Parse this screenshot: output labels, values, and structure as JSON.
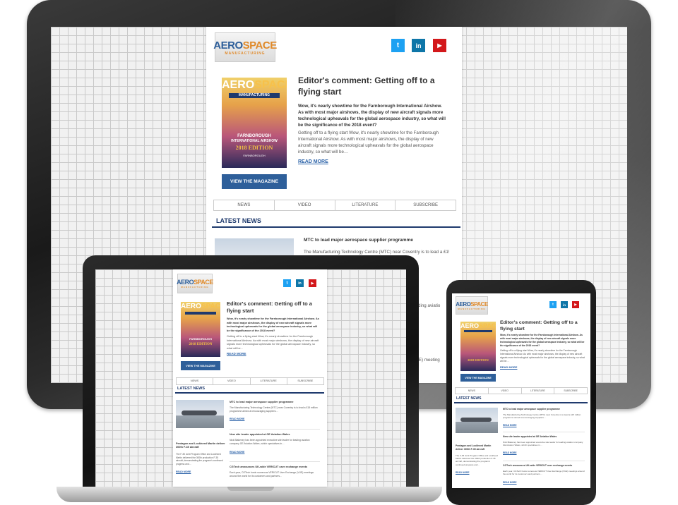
{
  "email": {
    "logo_main_a": "AERO",
    "logo_main_b": "SPACE",
    "logo_sub": "MANUFACTURING",
    "social": [
      "t",
      "in",
      "▶"
    ],
    "cover": {
      "title_a": "AERO",
      "title_b": "SPACE",
      "subtitle": "MANUFACTURING",
      "show_line1": "FARNBOROUGH",
      "show_line2": "INTERNATIONAL AIRSHOW",
      "edition": "2018 EDITION",
      "brand": "FARNBOROUGH",
      "brand_sub": "INTERNATIONAL AIRSHOW"
    },
    "headline": "Editor's comment: Getting off to a flying start",
    "intro_bold": "Wow, it's nearly showtime for the Farnborough International Airshow. As with most major airshows, the display of new aircraft signals more technological upheavals for the global aerospace industry, so what will be the significance of the 2018 event?",
    "intro": "Getting off to a flying start Wow, it's nearly showtime for the Farnborough International Airshow. As with most major airshows, the display of new aircraft signals more technological upheavals for the global aerospace industry, so what will be…",
    "read_more": "READ MORE",
    "view_magazine": "VIEW THE MAGAZINE",
    "nav": [
      "NEWS",
      "VIDEO",
      "LITERATURE",
      "SUBSCRIBE"
    ],
    "latest_news": "LATEST NEWS",
    "items": [
      {
        "title": "MTC to lead major aerospace supplier programme",
        "body": "The Manufacturing Technology Centre (MTC) near Coventry is to lead a £15 million programme aimed at encouraging suppliers…",
        "more": "READ MORE"
      },
      {
        "title": "New site leader appointed at GE Aviation Wales",
        "body": "Nick Blakeney has been appointed executive site leader for leading aviation company GE Aviation Wales, which specialises in…",
        "more": "READ MORE"
      },
      {
        "title": "CGTech announces UK-wide VERICUT user exchange events",
        "body": "Each year, CGTech hosts numerous VERICUT User Exchange (VUE) meetings around the world for its customers and partners…",
        "more": "READ MORE"
      }
    ],
    "feature": {
      "title": "Pentagon and Lockheed Martin deliver 300th F-35 aircraft",
      "body": "The F-35 Joint Program Office and Lockheed Martin delivered the 300th production F-35 aircraft, demonstrating the program's continued progress and…",
      "more": "READ MORE"
    },
    "monitor_peek": {
      "item1_tail": "r leading aviatio",
      "item2_tail": "ents",
      "item3_tail": "e (VUE) meeting"
    }
  },
  "colors": {
    "brand_blue": "#2e5f9a",
    "brand_orange": "#e08a2a",
    "twitter": "#1da1f2",
    "linkedin": "#0e76a8",
    "youtube": "#d3181b"
  }
}
